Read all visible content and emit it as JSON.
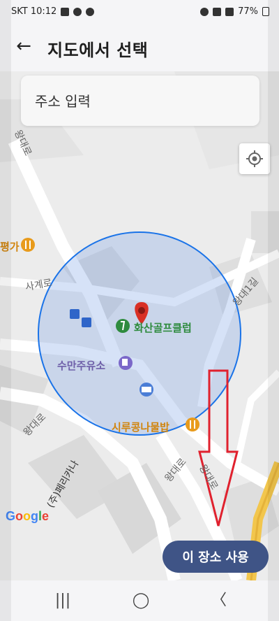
{
  "status_bar": {
    "carrier_time": "SKT 10:12",
    "battery": "77%"
  },
  "app_bar": {
    "back_icon": "arrow-left-icon",
    "title": "지도에서 선택"
  },
  "search": {
    "placeholder": "주소 입력"
  },
  "map": {
    "locate_icon": "my-location-icon",
    "labels": {
      "wangdaero_1": "왕대로",
      "wangdaero_2": "왕대로",
      "wangdaero_3": "왕대로",
      "wangdaero_4": "왕대로",
      "wangdae1gil": "왕대1길",
      "sagyero": "사계로",
      "golf": "화산골프클럽",
      "gas": "수만주유소",
      "restaurant": "시루콩나물밥",
      "restaurant_left": "평가",
      "company": "(주)페리카나"
    },
    "google": [
      "G",
      "o",
      "o",
      "g",
      "l",
      "e"
    ],
    "google_colors": [
      "#4285F4",
      "#EA4335",
      "#FBBC05",
      "#4285F4",
      "#34A853",
      "#EA4335"
    ],
    "accent_circle_color": "#1a73e8",
    "pin_color": "#d93025",
    "arrow_color": "#e0212e"
  },
  "actions": {
    "use_place": "이 장소 사용"
  },
  "nav_bar": {
    "recent": "|||",
    "home": "◯",
    "back": "〈"
  }
}
